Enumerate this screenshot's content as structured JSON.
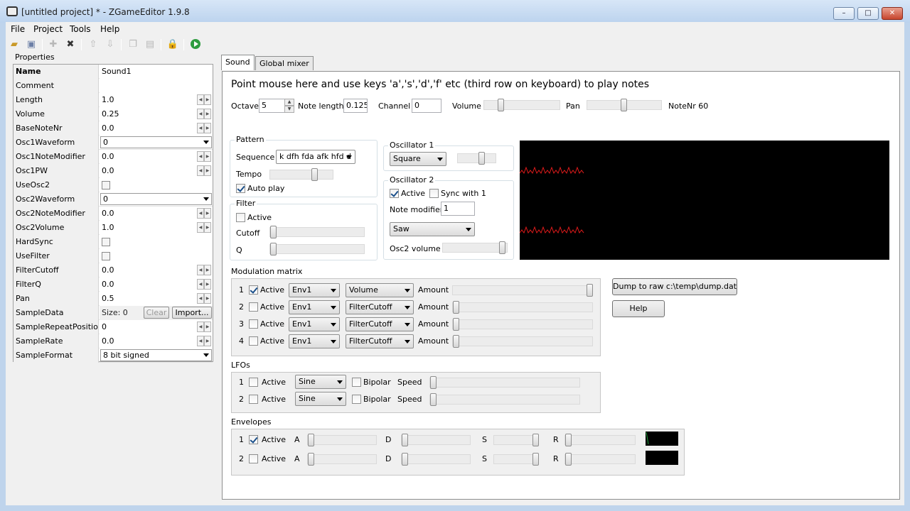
{
  "window": {
    "title": "[untitled project] * - ZGameEditor 1.9.8",
    "minimize": "–",
    "maximize": "□",
    "close": "✕"
  },
  "menu": [
    "File",
    "Project",
    "Tools",
    "Help"
  ],
  "properties": {
    "header": "Properties",
    "rows": [
      {
        "name": "Name",
        "value": "Sound1",
        "kind": "text"
      },
      {
        "name": "Comment",
        "value": "",
        "kind": "text"
      },
      {
        "name": "Length",
        "value": "1.0",
        "kind": "spin"
      },
      {
        "name": "Volume",
        "value": "0.25",
        "kind": "spin"
      },
      {
        "name": "BaseNoteNr",
        "value": "0.0",
        "kind": "spin"
      },
      {
        "name": "Osc1Waveform",
        "value": "0",
        "kind": "combo"
      },
      {
        "name": "Osc1NoteModifier",
        "value": "0.0",
        "kind": "spin"
      },
      {
        "name": "Osc1PW",
        "value": "0.0",
        "kind": "spin"
      },
      {
        "name": "UseOsc2",
        "value": "",
        "kind": "check"
      },
      {
        "name": "Osc2Waveform",
        "value": "0",
        "kind": "combo"
      },
      {
        "name": "Osc2NoteModifier",
        "value": "0.0",
        "kind": "spin"
      },
      {
        "name": "Osc2Volume",
        "value": "1.0",
        "kind": "spin"
      },
      {
        "name": "HardSync",
        "value": "",
        "kind": "check"
      },
      {
        "name": "UseFilter",
        "value": "",
        "kind": "check"
      },
      {
        "name": "FilterCutoff",
        "value": "0.0",
        "kind": "spin"
      },
      {
        "name": "FilterQ",
        "value": "0.0",
        "kind": "spin"
      },
      {
        "name": "Pan",
        "value": "0.5",
        "kind": "spin"
      },
      {
        "name": "SampleData",
        "value": "Size: 0",
        "kind": "sample"
      },
      {
        "name": "SampleRepeatPosition",
        "value": "0",
        "kind": "spin"
      },
      {
        "name": "SampleRate",
        "value": "0.0",
        "kind": "spin"
      },
      {
        "name": "SampleFormat",
        "value": "8 bit signed",
        "kind": "combo"
      }
    ],
    "clear_label": "Clear",
    "import_label": "Import..."
  },
  "tabs": [
    "Sound",
    "Global mixer"
  ],
  "sound": {
    "hint": "Point mouse here and use keys 'a','s','d','f' etc (third row on keyboard) to play notes",
    "octave_label": "Octave",
    "octave": "5",
    "note_length_label": "Note length",
    "note_length": "0.125",
    "channel_label": "Channel",
    "channel": "0",
    "volume_label": "Volume",
    "volume_level": 0.2,
    "pan_label": "Pan",
    "pan_level": 0.5,
    "notenr": "NoteNr 60",
    "pattern": {
      "title": "Pattern",
      "sequence_label": "Sequence",
      "sequence": "k dfh fda afk hfd  d",
      "tempo_label": "Tempo",
      "tempo_level": 0.75,
      "autoplay_label": "Auto play",
      "autoplay": true
    },
    "filter": {
      "title": "Filter",
      "active_label": "Active",
      "cutoff_label": "Cutoff",
      "q_label": "Q"
    },
    "osc1": {
      "title": "Oscillator 1",
      "waveform": "Square",
      "level": 0.7
    },
    "osc2": {
      "title": "Oscillator 2",
      "active_label": "Active",
      "sync_label": "Sync with 1",
      "note_modifier_label": "Note modifier",
      "note_modifier": "1",
      "waveform": "Saw",
      "volume_label": "Osc2 volume",
      "volume_level": 1.0
    }
  },
  "modmatrix": {
    "title": "Modulation matrix",
    "rows": [
      {
        "n": "1",
        "active": true,
        "source": "Env1",
        "target": "Volume",
        "amount": 1.0
      },
      {
        "n": "2",
        "active": false,
        "source": "Env1",
        "target": "FilterCutoff",
        "amount": 0.0
      },
      {
        "n": "3",
        "active": false,
        "source": "Env1",
        "target": "FilterCutoff",
        "amount": 0.0
      },
      {
        "n": "4",
        "active": false,
        "source": "Env1",
        "target": "FilterCutoff",
        "amount": 0.0
      }
    ],
    "active_label": "Active",
    "amount_label": "Amount"
  },
  "buttons": {
    "dump": "Dump to raw c:\\temp\\dump.dat",
    "help": "Help"
  },
  "lfos": {
    "title": "LFOs",
    "rows": [
      {
        "n": "1",
        "active": false,
        "wave": "Sine",
        "bipolar": false
      },
      {
        "n": "2",
        "active": false,
        "wave": "Sine",
        "bipolar": false
      }
    ],
    "active_label": "Active",
    "bipolar_label": "Bipolar",
    "speed_label": "Speed"
  },
  "envelopes": {
    "title": "Envelopes",
    "rows": [
      {
        "n": "1",
        "active": true
      },
      {
        "n": "2",
        "active": false
      }
    ],
    "active_label": "Active",
    "a": "A",
    "d": "D",
    "s": "S",
    "r": "R"
  },
  "colors": {
    "scope_bg": "#000000",
    "waveform": "#e21b1b",
    "env_line": "#1e9e3a"
  },
  "icons": [
    "open-folder-icon",
    "save-icon",
    "add-icon",
    "delete-icon",
    "move-up-icon",
    "move-down-icon",
    "copy-icon",
    "paste-icon",
    "lock-icon",
    "run-icon"
  ]
}
